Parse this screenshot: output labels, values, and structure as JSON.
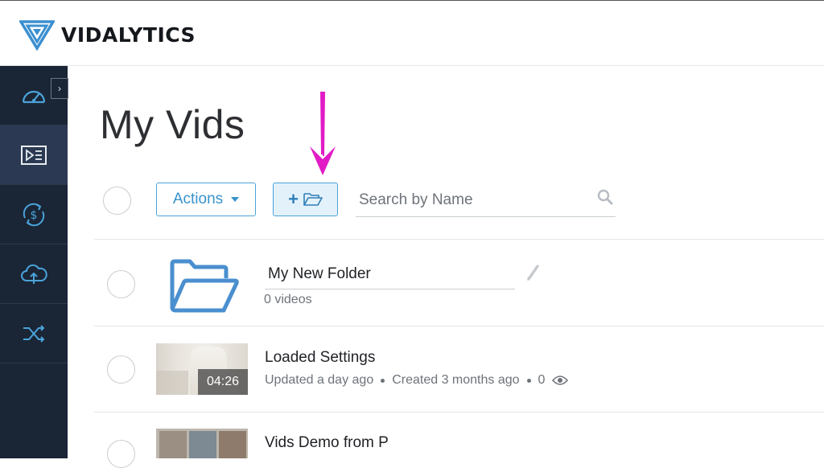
{
  "app": {
    "name": "VIDALYTICS"
  },
  "sidebar": {
    "collapse_icon": "chevron-right-icon",
    "items": [
      {
        "name": "dashboard",
        "icon": "speedometer-icon",
        "active": false
      },
      {
        "name": "videos",
        "icon": "video-list-icon",
        "active": true
      },
      {
        "name": "monetization",
        "icon": "dollar-cycle-icon",
        "active": false
      },
      {
        "name": "upload",
        "icon": "cloud-upload-icon",
        "active": false
      },
      {
        "name": "split-test",
        "icon": "shuffle-icon",
        "active": false
      }
    ]
  },
  "page": {
    "title": "My Vids"
  },
  "toolbar": {
    "actions_label": "Actions",
    "new_folder_plus": "+",
    "new_folder_icon": "folder-open-icon",
    "search_placeholder": "Search by Name",
    "search_value": ""
  },
  "folders": [
    {
      "name": "My New Folder",
      "count": "0 videos"
    }
  ],
  "videos": [
    {
      "title": "Loaded Settings",
      "duration": "04:26",
      "updated": "Updated a day ago",
      "created": "Created 3 months ago",
      "views": "0"
    },
    {
      "title": "Vids Demo from P"
    }
  ],
  "colors": {
    "sidebar_bg": "#1a2536",
    "sidebar_active": "#2b3a52",
    "accent_blue": "#3793cc",
    "annotation_arrow": "#e11bc6"
  }
}
